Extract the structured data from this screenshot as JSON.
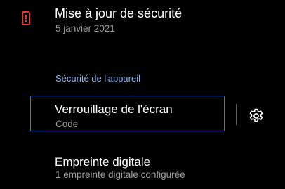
{
  "colors": {
    "background": "#000000",
    "primary_text": "#ffffff",
    "secondary_text": "#9e9e9e",
    "section_header": "#8ab4f8",
    "focus_outline": "#2f7bd8",
    "alert_icon": "#e53935"
  },
  "security_update": {
    "icon": "phone-alert-icon",
    "title": "Mise à jour de sécurité",
    "subtitle": "5 janvier 2021"
  },
  "device_security": {
    "header": "Sécurité de l'appareil",
    "items": [
      {
        "title": "Verrouillage de l'écran",
        "subtitle": "Code",
        "trailing_icon": "gear-icon",
        "focused": true
      },
      {
        "title": "Empreinte digitale",
        "subtitle": "1 empreinte digitale configurée"
      }
    ]
  }
}
